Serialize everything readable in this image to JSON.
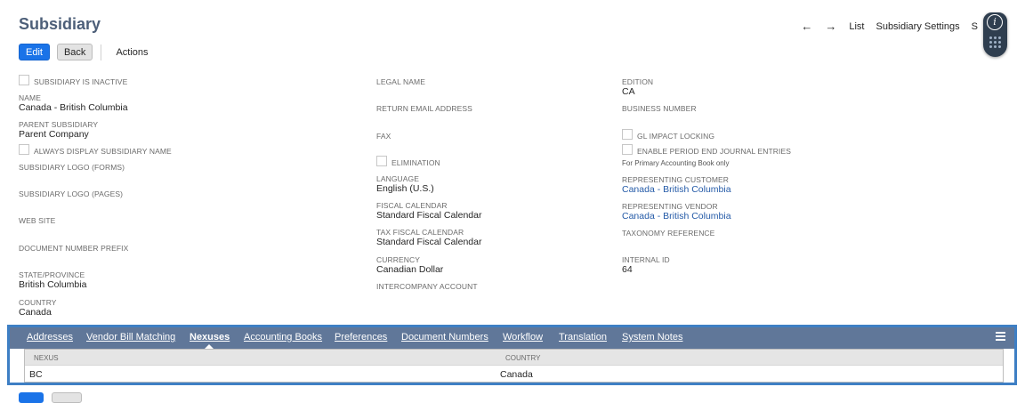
{
  "page": {
    "title": "Subsidiary"
  },
  "topnav": {
    "back_arrow": "←",
    "forward_arrow": "→",
    "list": "List",
    "settings": "Subsidiary Settings",
    "truncated": "S"
  },
  "help_bubble": {
    "info_glyph": "i"
  },
  "buttons": {
    "edit": "Edit",
    "back": "Back",
    "actions": "Actions"
  },
  "col1": {
    "inactive_label": "SUBSIDIARY IS INACTIVE",
    "name_label": "NAME",
    "name_value": "Canada - British Columbia",
    "parent_label": "PARENT SUBSIDIARY",
    "parent_value": "Parent Company",
    "always_display_label": "ALWAYS DISPLAY SUBSIDIARY NAME",
    "logo_forms_label": "SUBSIDIARY LOGO (FORMS)",
    "logo_pages_label": "SUBSIDIARY LOGO (PAGES)",
    "web_site_label": "WEB SITE",
    "doc_prefix_label": "DOCUMENT NUMBER PREFIX",
    "state_label": "STATE/PROVINCE",
    "state_value": "British Columbia",
    "country_label": "COUNTRY",
    "country_value": "Canada"
  },
  "col2": {
    "legal_name_label": "LEGAL NAME",
    "return_email_label": "RETURN EMAIL ADDRESS",
    "fax_label": "FAX",
    "elimination_label": "ELIMINATION",
    "language_label": "LANGUAGE",
    "language_value": "English (U.S.)",
    "fiscal_label": "FISCAL CALENDAR",
    "fiscal_value": "Standard Fiscal Calendar",
    "tax_fiscal_label": "TAX FISCAL CALENDAR",
    "tax_fiscal_value": "Standard Fiscal Calendar",
    "currency_label": "CURRENCY",
    "currency_value": "Canadian Dollar",
    "intercompany_label": "INTERCOMPANY ACCOUNT"
  },
  "col3": {
    "edition_label": "EDITION",
    "edition_value": "CA",
    "business_number_label": "BUSINESS NUMBER",
    "gl_impact_label": "GL IMPACT LOCKING",
    "period_end_label": "ENABLE PERIOD END JOURNAL ENTRIES",
    "period_end_note": "For Primary Accounting Book only",
    "rep_customer_label": "REPRESENTING CUSTOMER",
    "rep_customer_value": "Canada - British Columbia",
    "rep_vendor_label": "REPRESENTING VENDOR",
    "rep_vendor_value": "Canada - British Columbia",
    "taxonomy_label": "TAXONOMY REFERENCE",
    "internal_id_label": "INTERNAL ID",
    "internal_id_value": "64"
  },
  "tabs": [
    {
      "label": "Addresses"
    },
    {
      "label": "Vendor Bill Matching"
    },
    {
      "label": "Nexuses"
    },
    {
      "label": "Accounting Books"
    },
    {
      "label": "Preferences"
    },
    {
      "label": "Document Numbers"
    },
    {
      "label": "Workflow"
    },
    {
      "label": "Translation"
    },
    {
      "label": "System Notes"
    }
  ],
  "nexus_table": {
    "headers": [
      "NEXUS",
      "COUNTRY"
    ],
    "rows": [
      [
        "BC",
        "Canada"
      ]
    ]
  },
  "colors": {
    "title": "#4d5f79",
    "primary_button": "#1a73e8",
    "tab_bar": "#607799",
    "focus_border": "#3e7fc4",
    "link": "#255ba8"
  }
}
